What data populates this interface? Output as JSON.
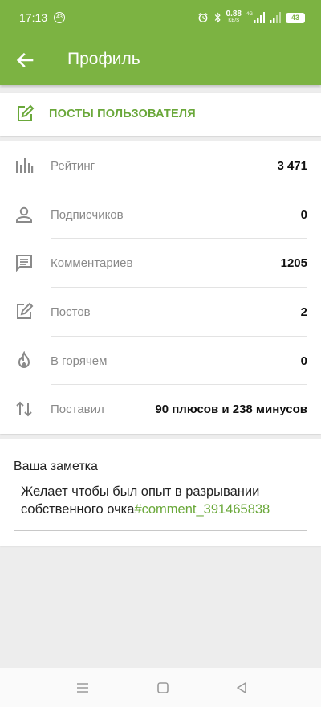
{
  "status_bar": {
    "time": "17:13",
    "notification_badge": "43",
    "net_speed": "0.88",
    "net_speed_unit": "KB/S",
    "network_type": "4G",
    "battery": "43"
  },
  "app_bar": {
    "title": "Профиль",
    "back_icon": "arrow-left-icon"
  },
  "posts_link": {
    "label": "ПОСТЫ ПОЛЬЗОВАТЕЛЯ",
    "icon": "edit-square-icon"
  },
  "stats": [
    {
      "icon": "bar-chart-icon",
      "label": "Рейтинг",
      "value": "3 471"
    },
    {
      "icon": "person-icon",
      "label": "Подписчиков",
      "value": "0"
    },
    {
      "icon": "comment-icon",
      "label": "Комментариев",
      "value": "1205"
    },
    {
      "icon": "edit-square-icon",
      "label": "Постов",
      "value": "2"
    },
    {
      "icon": "flame-icon",
      "label": "В горячем",
      "value": "0"
    },
    {
      "icon": "swap-vertical-icon",
      "label": "Поставил",
      "value": "90 плюсов и 238 минусов"
    }
  ],
  "note": {
    "title": "Ваша заметка",
    "text": "Желает чтобы был опыт в разрывании собственного очка",
    "link": "#comment_391465838"
  },
  "colors": {
    "accent": "#7cb342",
    "accent_text": "#6aa83a",
    "background": "#ededed"
  }
}
